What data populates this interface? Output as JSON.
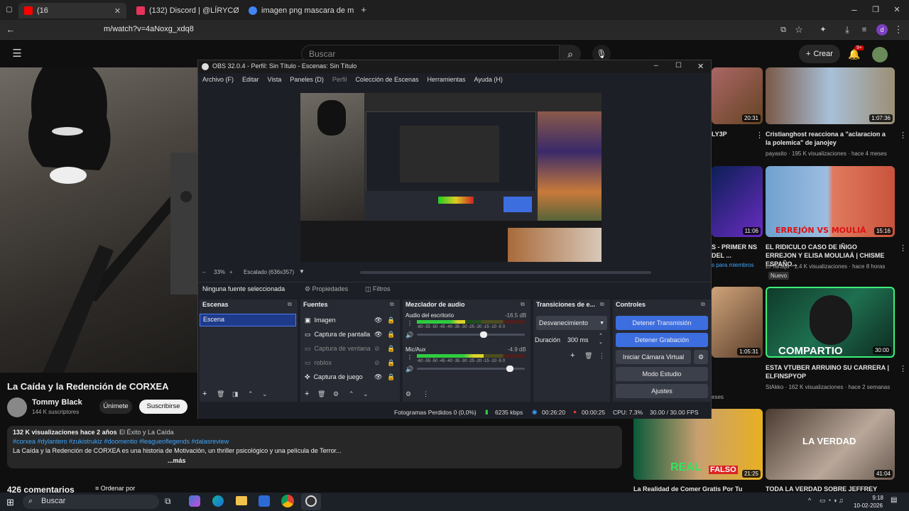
{
  "browser": {
    "tabs": [
      {
        "label": "(16",
        "color": "#ff0000"
      },
      {
        "label": "(132) Discord | @LÍRYCØ",
        "color": "#e8325a"
      },
      {
        "label": "imagen png mascara de monta",
        "color": "#4285f4"
      }
    ],
    "url": "m/watch?v=4aNoxg_xdq8"
  },
  "youtube": {
    "search_placeholder": "Buscar",
    "create_label": "Crear",
    "notif_count": "9+",
    "video_title": "La Caída y la Redención de CORXEA",
    "channel": "Tommy Black",
    "subscribers": "144 K suscriptores",
    "join_label": "Únimete",
    "subscribe_label": "Suscribirse",
    "views_line": "132 K visualizaciones  hace 2 años",
    "desc_tag": "El Éxito y La Caída",
    "hashtags": "#corxea #dylantero #zukistrukiz #doomentio #leagueoflegends #dalasreview",
    "desc_text": "La Caída y la Redención de CORXEA es una historia de Motivación, un thriller psicológico y una película de Terror...",
    "more": "...más",
    "comments": "426 comentarios",
    "sort_label": "Ordenar por",
    "recommendations": [
      {
        "title": "Cristianghost reacciona a \"aclaracion a la polemica\" de janojey",
        "meta1": "payasito · 195 K visualizaciones · hace 4 meses",
        "meta2": "",
        "duration": "1:07:36",
        "left_dur": "20:31",
        "left_text": "LY3P"
      },
      {
        "title": "EL RIDICULO CASO DE IÑIGO ERREJON Y ELISA MOULIAÁ | CHISME ESPAÑO...",
        "meta1": "El Tartaja · 1,4 K visualizaciones · hace 8 horas",
        "meta2": "Nuevo",
        "duration": "15:16",
        "left_dur": "11:06",
        "left_text": "S - PRIMER NS DEL ...",
        "left_meta": "s para miembros"
      },
      {
        "title": "ESTA VTUBER ARRUINO SU CARRERA | ELFINSPYOP",
        "meta1": "StAkko · 162 K visualizaciones · hace 2 semanas",
        "meta2": "",
        "duration": "30:00",
        "left_dur": "1:05:31",
        "left_text": "",
        "left_meta": "eses"
      },
      {
        "title": "TODA LA VERDAD SOBRE JEFFREY",
        "meta1": "",
        "meta2": "",
        "duration": "41:04",
        "left_dur": "21:25",
        "left_text": "La Realidad de Comer Gratis Por Tu"
      }
    ],
    "thumb_text": {
      "errejon": "ERREJÓN VS MOULIÁ",
      "compartio": "COMPARTIO",
      "verdad": "LA VERDAD",
      "real": "REAL",
      "falso": "FALSO"
    }
  },
  "obs": {
    "title": "OBS 32.0.4 - Perfil: Sin Título - Escenas: Sin Título",
    "menu": [
      "Archivo (F)",
      "Editar",
      "Vista",
      "Paneles (D)",
      "Perfil",
      "Colección de Escenas",
      "Herramientas",
      "Ayuda (H)"
    ],
    "zoom": "33%",
    "scaling": "Escalado (636x357)",
    "no_source": "Ninguna fuente seleccionada",
    "properties": "Propiedades",
    "filters": "Filtros",
    "scenes_title": "Escenas",
    "scenes": [
      "Escena"
    ],
    "sources_title": "Fuentes",
    "sources": [
      "Imagen",
      "Captura de pantalla",
      "Captura de ventana",
      "roblox",
      "Captura de juego"
    ],
    "mixer_title": "Mezclador de audio",
    "desktop_audio": "Audio del escritorio",
    "desktop_db": "-16.5 dB",
    "mic": "Mic/Aux",
    "mic_db": "-4.9 dB",
    "meter_scale": "-60 -55 -50 -45 -40 -35 -30 -25 -20 -15 -10 -5 0",
    "desktop_level": 0.62,
    "mic_level": 0.86,
    "transitions_title": "Transiciones de e...",
    "transition": "Desvanecimiento",
    "duration_label": "Duración",
    "duration": "300 ms",
    "controls_title": "Controles",
    "btn_stream": "Detener Transmisión",
    "btn_record": "Detener Grabación",
    "btn_vcam": "Iniciar Cámara Virtual",
    "btn_studio": "Modo Estudio",
    "btn_settings": "Ajustes",
    "status": {
      "dropped": "Fotogramas Perdidos 0 (0,0%)",
      "kbps": "6235 kbps",
      "stream_time": "00:26:20",
      "rec_time": "00:00:25",
      "cpu": "CPU: 7.3%",
      "fps": "30.00 / 30.00 FPS"
    }
  },
  "taskbar": {
    "search": "Buscar",
    "time": "9:18",
    "date": "10-02-2026"
  }
}
